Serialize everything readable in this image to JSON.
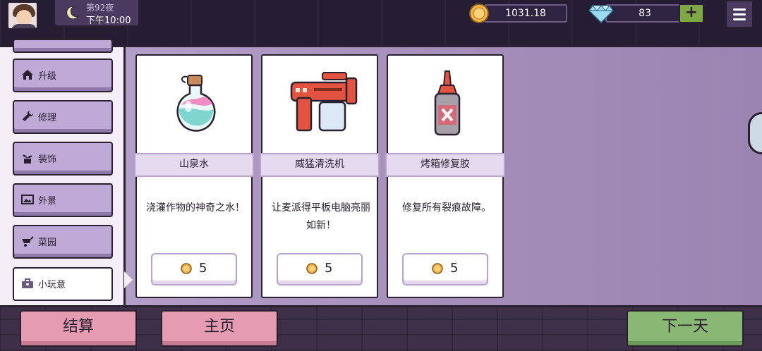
{
  "hud": {
    "day": "第92夜",
    "time": "下午10:00",
    "coins": "1031.18",
    "gems": "83",
    "plus_label": "+"
  },
  "sidebar": {
    "items": [
      {
        "label": "升级",
        "icon": "house-icon"
      },
      {
        "label": "修理",
        "icon": "wrench-icon"
      },
      {
        "label": "装饰",
        "icon": "plant-icon"
      },
      {
        "label": "外景",
        "icon": "landscape-icon"
      },
      {
        "label": "菜园",
        "icon": "wheelbarrow-icon"
      },
      {
        "label": "小玩意",
        "icon": "toolbox-icon"
      }
    ],
    "active_index": 5
  },
  "items": [
    {
      "name": "山泉水",
      "desc": "浇灌作物的神奇之水！",
      "price": "5",
      "icon": "potion-flask-icon"
    },
    {
      "name": "威猛清洗机",
      "desc": "让麦派得平板电脑亮丽如新！",
      "price": "5",
      "icon": "spray-gun-icon"
    },
    {
      "name": "烤箱修复胶",
      "desc": "修复所有裂痕故障。",
      "price": "5",
      "icon": "glue-bottle-icon"
    }
  ],
  "bottom": {
    "settle_label": "结算",
    "home_label": "主页",
    "next_day_label": "下一天"
  },
  "colors": {
    "panel": "#a48eb9",
    "button_pink": "#e59cb3",
    "button_green": "#88b873",
    "accent_dark": "#2a2030"
  }
}
